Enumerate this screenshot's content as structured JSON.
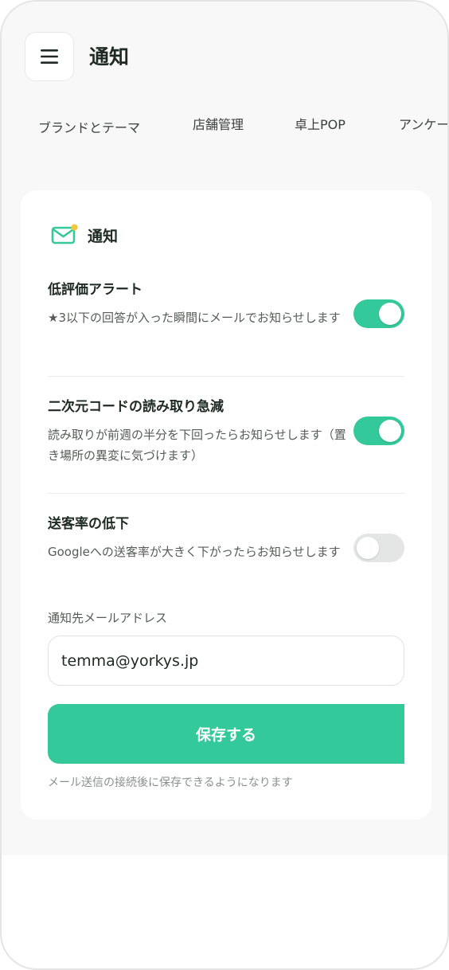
{
  "header": {
    "title": "通知",
    "menu_icon": "hamburger-menu-icon"
  },
  "tabs": [
    {
      "label": "ブランドとテーマ"
    },
    {
      "label": "店舗管理"
    },
    {
      "label": "卓上POP"
    },
    {
      "label": "アンケート"
    }
  ],
  "card": {
    "icon": "mail-icon",
    "title": "通知",
    "settings": [
      {
        "title": "低評価アラート",
        "description": "★3以下の回答が入った瞬間にメールでお知らせします",
        "enabled": true
      },
      {
        "title": "二次元コードの読み取り急減",
        "description": "読み取りが前週の半分を下回ったらお知らせします（置き場所の異変に気づけます）",
        "enabled": true
      },
      {
        "title": "送客率の低下",
        "description": "Googleへの送客率が大きく下がったらお知らせします",
        "enabled": false
      }
    ],
    "email": {
      "label": "通知先メールアドレス",
      "value": "temma@yorkys.jp"
    },
    "save_label": "保存する",
    "note": "メール送信の接続後に保存できるようになります"
  },
  "colors": {
    "accent": "#34c99a",
    "toggle_off": "#e4e6e5",
    "badge_dot": "#f5c542"
  }
}
